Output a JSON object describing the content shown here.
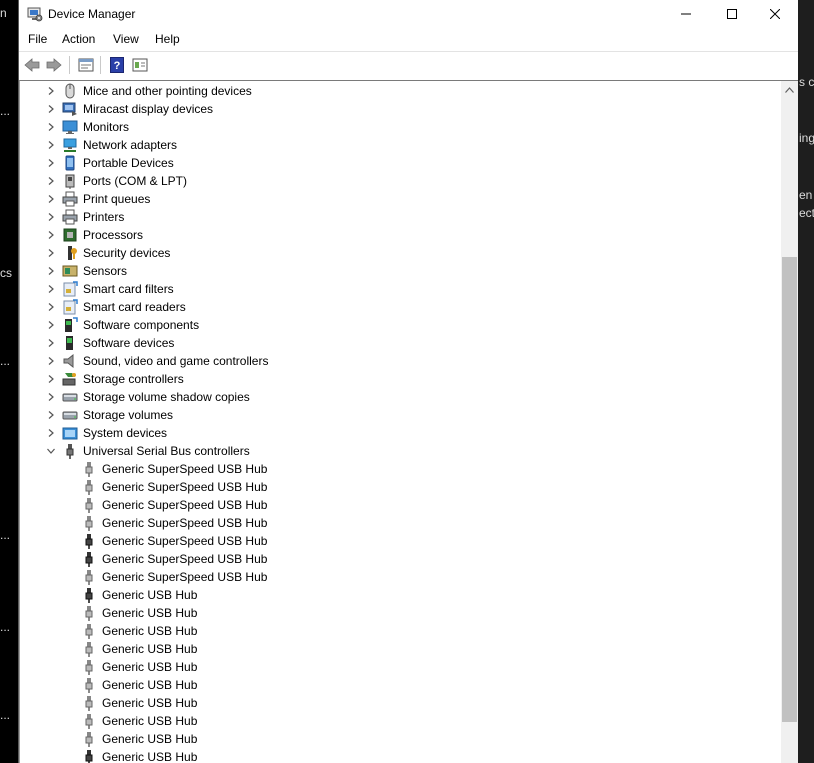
{
  "window": {
    "title": "Device Manager"
  },
  "menu": [
    "File",
    "Action",
    "View",
    "Help"
  ],
  "toolbar": {
    "buttons": [
      "back-icon",
      "forward-icon",
      "properties-icon",
      "help-icon",
      "view-icon"
    ]
  },
  "categories": [
    {
      "label": "Mice and other pointing devices",
      "icon": "mouse-icon"
    },
    {
      "label": "Miracast display devices",
      "icon": "miracast-icon"
    },
    {
      "label": "Monitors",
      "icon": "monitor-icon"
    },
    {
      "label": "Network adapters",
      "icon": "network-icon"
    },
    {
      "label": "Portable Devices",
      "icon": "portable-icon"
    },
    {
      "label": "Ports (COM & LPT)",
      "icon": "port-icon"
    },
    {
      "label": "Print queues",
      "icon": "printer-icon"
    },
    {
      "label": "Printers",
      "icon": "printer-icon"
    },
    {
      "label": "Processors",
      "icon": "processor-icon"
    },
    {
      "label": "Security devices",
      "icon": "security-icon"
    },
    {
      "label": "Sensors",
      "icon": "sensor-icon"
    },
    {
      "label": "Smart card filters",
      "icon": "smartcard-icon"
    },
    {
      "label": "Smart card readers",
      "icon": "smartcard-icon"
    },
    {
      "label": "Software components",
      "icon": "software-component-icon"
    },
    {
      "label": "Software devices",
      "icon": "software-device-icon"
    },
    {
      "label": "Sound, video and game controllers",
      "icon": "speaker-icon"
    },
    {
      "label": "Storage controllers",
      "icon": "storage-controller-icon"
    },
    {
      "label": "Storage volume shadow copies",
      "icon": "drive-icon"
    },
    {
      "label": "Storage volumes",
      "icon": "drive-icon"
    },
    {
      "label": "System devices",
      "icon": "system-icon"
    },
    {
      "label": "Universal Serial Bus controllers",
      "icon": "usb-icon",
      "expanded": true
    }
  ],
  "usb_children": [
    "Generic SuperSpeed USB Hub",
    "Generic SuperSpeed USB Hub",
    "Generic SuperSpeed USB Hub",
    "Generic SuperSpeed USB Hub",
    "Generic SuperSpeed USB Hub",
    "Generic SuperSpeed USB Hub",
    "Generic SuperSpeed USB Hub",
    "Generic USB Hub",
    "Generic USB Hub",
    "Generic USB Hub",
    "Generic USB Hub",
    "Generic USB Hub",
    "Generic USB Hub",
    "Generic USB Hub",
    "Generic USB Hub",
    "Generic USB Hub",
    "Generic USB Hub"
  ],
  "background": {
    "left_fragments": [
      "n",
      "...",
      "cs",
      "...",
      "...",
      "...",
      "..."
    ],
    "right_fragments": [
      "s co",
      "ing",
      "en",
      "ect"
    ]
  }
}
